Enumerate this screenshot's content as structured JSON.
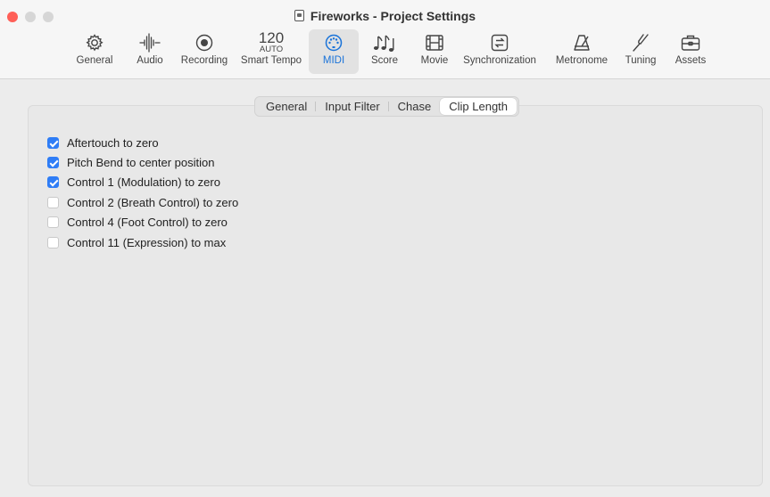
{
  "window": {
    "title": "Fireworks - Project Settings"
  },
  "toolbar": {
    "items": [
      {
        "label": "General",
        "icon": "gear-icon"
      },
      {
        "label": "Audio",
        "icon": "waveform-icon"
      },
      {
        "label": "Recording",
        "icon": "record-icon"
      },
      {
        "label": "Smart Tempo",
        "icon": "tempo-readout",
        "value": "120",
        "mode": "AUTO"
      },
      {
        "label": "MIDI",
        "icon": "midi-port-icon",
        "selected": true
      },
      {
        "label": "Score",
        "icon": "music-notes-icon"
      },
      {
        "label": "Movie",
        "icon": "film-icon"
      },
      {
        "label": "Synchronization",
        "icon": "sync-icon"
      },
      {
        "label": "Metronome",
        "icon": "metronome-icon"
      },
      {
        "label": "Tuning",
        "icon": "tuning-fork-icon"
      },
      {
        "label": "Assets",
        "icon": "briefcase-icon"
      }
    ]
  },
  "tabs": {
    "items": [
      "General",
      "Input Filter",
      "Chase",
      "Clip Length"
    ],
    "selected": "Clip Length"
  },
  "options": [
    {
      "label": "Aftertouch to zero",
      "checked": true
    },
    {
      "label": "Pitch Bend to center position",
      "checked": true
    },
    {
      "label": "Control 1 (Modulation) to zero",
      "checked": true
    },
    {
      "label": "Control 2 (Breath Control) to zero",
      "checked": false
    },
    {
      "label": "Control 4 (Foot Control) to zero",
      "checked": false
    },
    {
      "label": "Control 11 (Expression) to max",
      "checked": false
    }
  ],
  "colors": {
    "accent": "#2f7df6",
    "close": "#ff5f57",
    "inactive_light": "#d6d6d6"
  }
}
